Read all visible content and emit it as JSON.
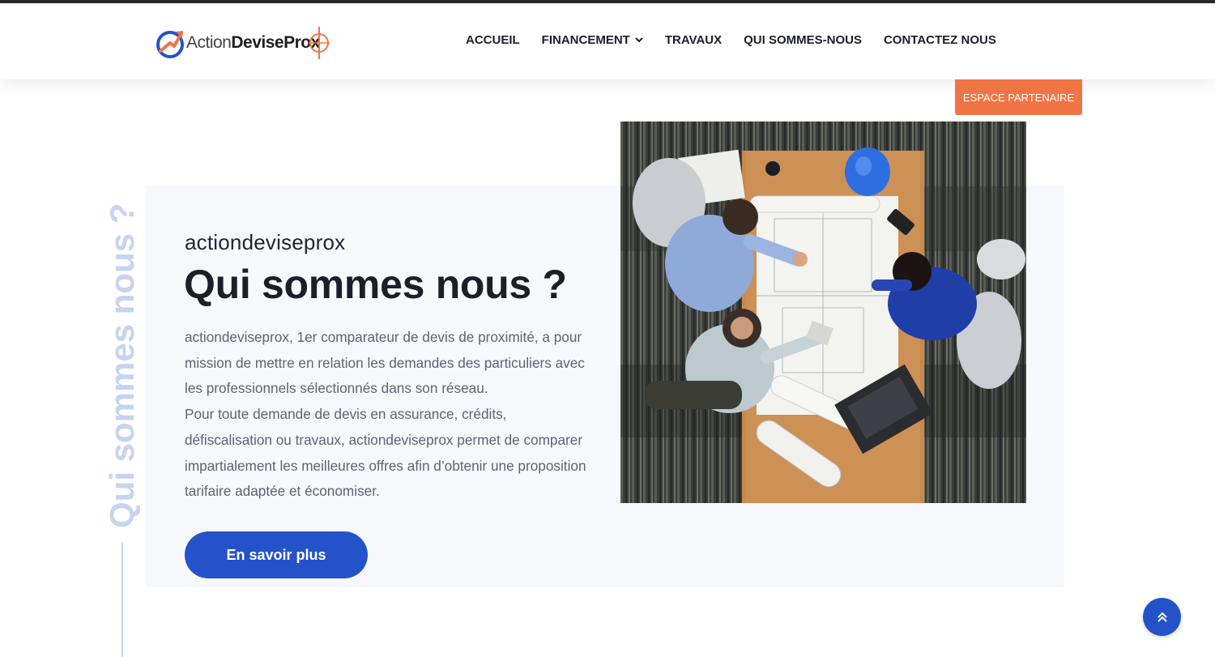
{
  "brand": {
    "logo_part1": "Action",
    "logo_part2": "DeviseProx",
    "accent_orange": "#f07444",
    "accent_blue": "#2453c9"
  },
  "nav": {
    "items": [
      {
        "label": "ACCUEIL"
      },
      {
        "label": "FINANCEMENT",
        "has_dropdown": true
      },
      {
        "label": "TRAVAUX"
      },
      {
        "label": "QUI SOMMES-NOUS"
      },
      {
        "label": "CONTACTEZ NOUS"
      }
    ]
  },
  "partner_button": {
    "label": "ESPACE PARTENAIRE"
  },
  "section": {
    "vertical_title": "Qui sommes nous ?",
    "eyebrow": "actiondeviseprox",
    "title": "Qui sommes nous ?",
    "paragraph_1": "actiondeviseprox, 1er comparateur de devis de proximité, a pour mission de mettre en relation les demandes des particuliers avec les professionnels sélectionnés dans son réseau.",
    "paragraph_2": "Pour toute demande de devis en assurance, crédits, défiscalisation ou travaux, actiondeviseprox permet de comparer impartialement les meilleures offres afin d’obtenir une proposition tarifaire adaptée et économiser.",
    "cta_label": "En savoir plus",
    "image_icon": "team-meeting-photo"
  },
  "scroll_top": {
    "icon": "double-chevron-up-icon"
  }
}
